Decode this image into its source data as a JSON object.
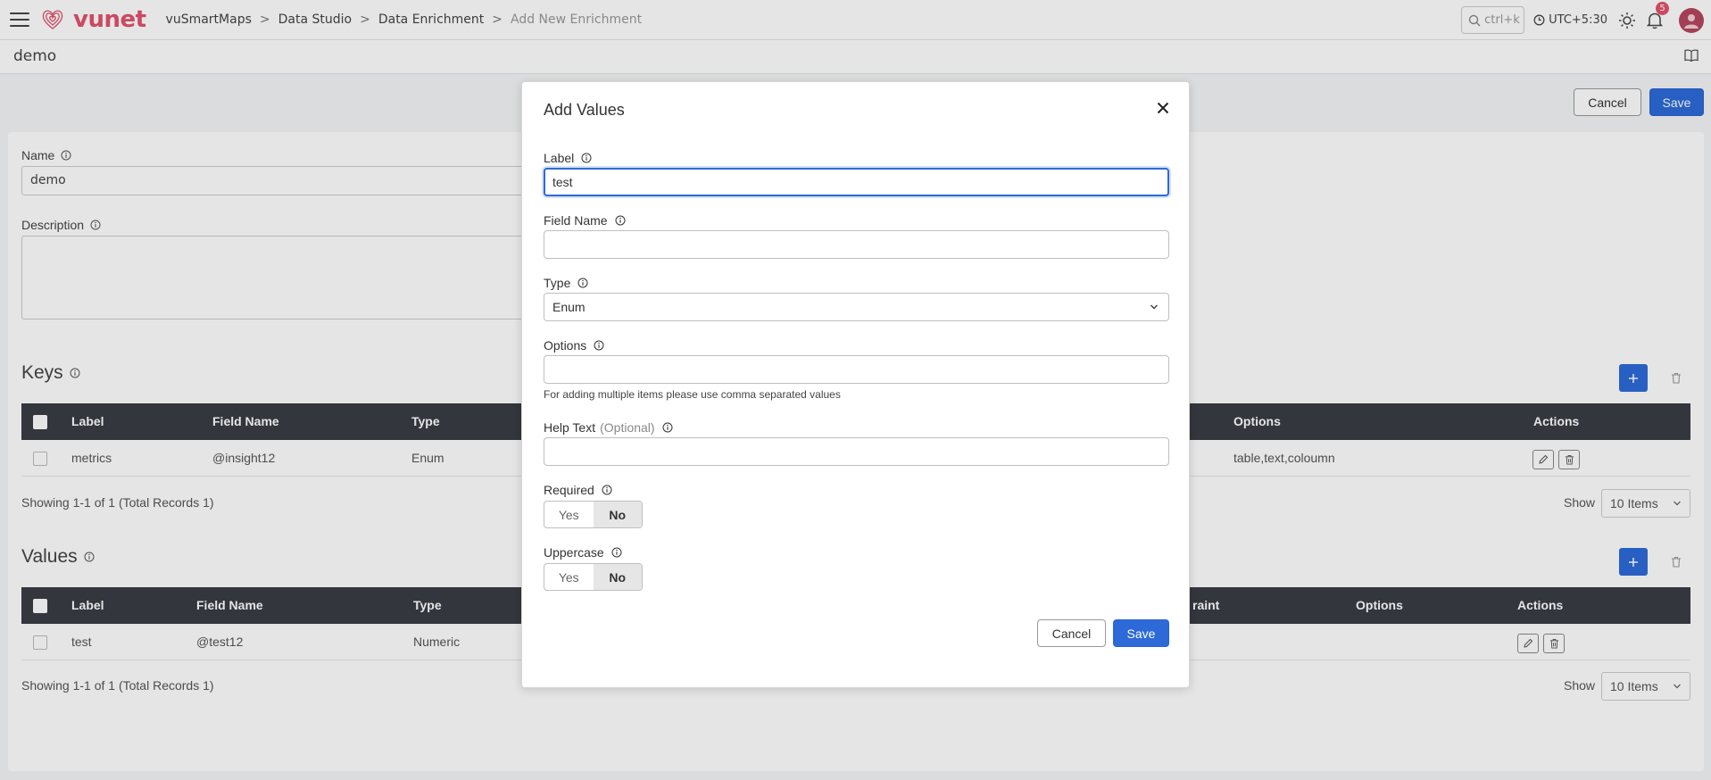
{
  "app": {
    "logo_text": "vunet",
    "breadcrumbs": [
      "vuSmartMaps",
      "Data Studio",
      "Data Enrichment",
      "Add New Enrichment"
    ],
    "search_placeholder": "ctrl+k",
    "timezone": "UTC+5:30",
    "notification_count": "5",
    "accent_color": "#e2526c",
    "primary_color": "#2d6ad8"
  },
  "page": {
    "title": "demo",
    "cancel_label": "Cancel",
    "save_label": "Save",
    "name_label": "Name",
    "name_value": "demo",
    "description_label": "Description"
  },
  "keys": {
    "title": "Keys",
    "columns": {
      "label": "Label",
      "field_name": "Field Name",
      "type": "Type",
      "options": "Options",
      "actions": "Actions"
    },
    "rows": [
      {
        "label": "metrics",
        "field_name": "@insight12",
        "type": "Enum",
        "options": "table,text,coloumn"
      }
    ],
    "showing": "Showing 1-1 of 1 (Total Records 1)",
    "show_label": "Show",
    "page_size": "10 Items"
  },
  "values": {
    "title": "Values",
    "columns": {
      "label": "Label",
      "field_name": "Field Name",
      "type": "Type",
      "constraint": "raint",
      "options": "Options",
      "actions": "Actions"
    },
    "rows": [
      {
        "label": "test",
        "field_name": "@test12",
        "type": "Numeric"
      }
    ],
    "showing": "Showing 1-1 of 1 (Total Records 1)",
    "show_label": "Show",
    "page_size": "10 Items"
  },
  "modal": {
    "title": "Add Values",
    "label_label": "Label",
    "label_value": "test",
    "field_name_label": "Field Name",
    "field_name_value": "",
    "type_label": "Type",
    "type_value": "Enum",
    "options_label": "Options",
    "options_value": "",
    "options_help": "For adding multiple items please use comma separated values",
    "help_text_label": "Help Text",
    "help_text_optional": "(Optional)",
    "help_text_value": "",
    "required_label": "Required",
    "required_yes": "Yes",
    "required_no": "No",
    "required_selected": "No",
    "uppercase_label": "Uppercase",
    "uppercase_yes": "Yes",
    "uppercase_no": "No",
    "uppercase_selected": "No",
    "cancel_label": "Cancel",
    "save_label": "Save"
  }
}
